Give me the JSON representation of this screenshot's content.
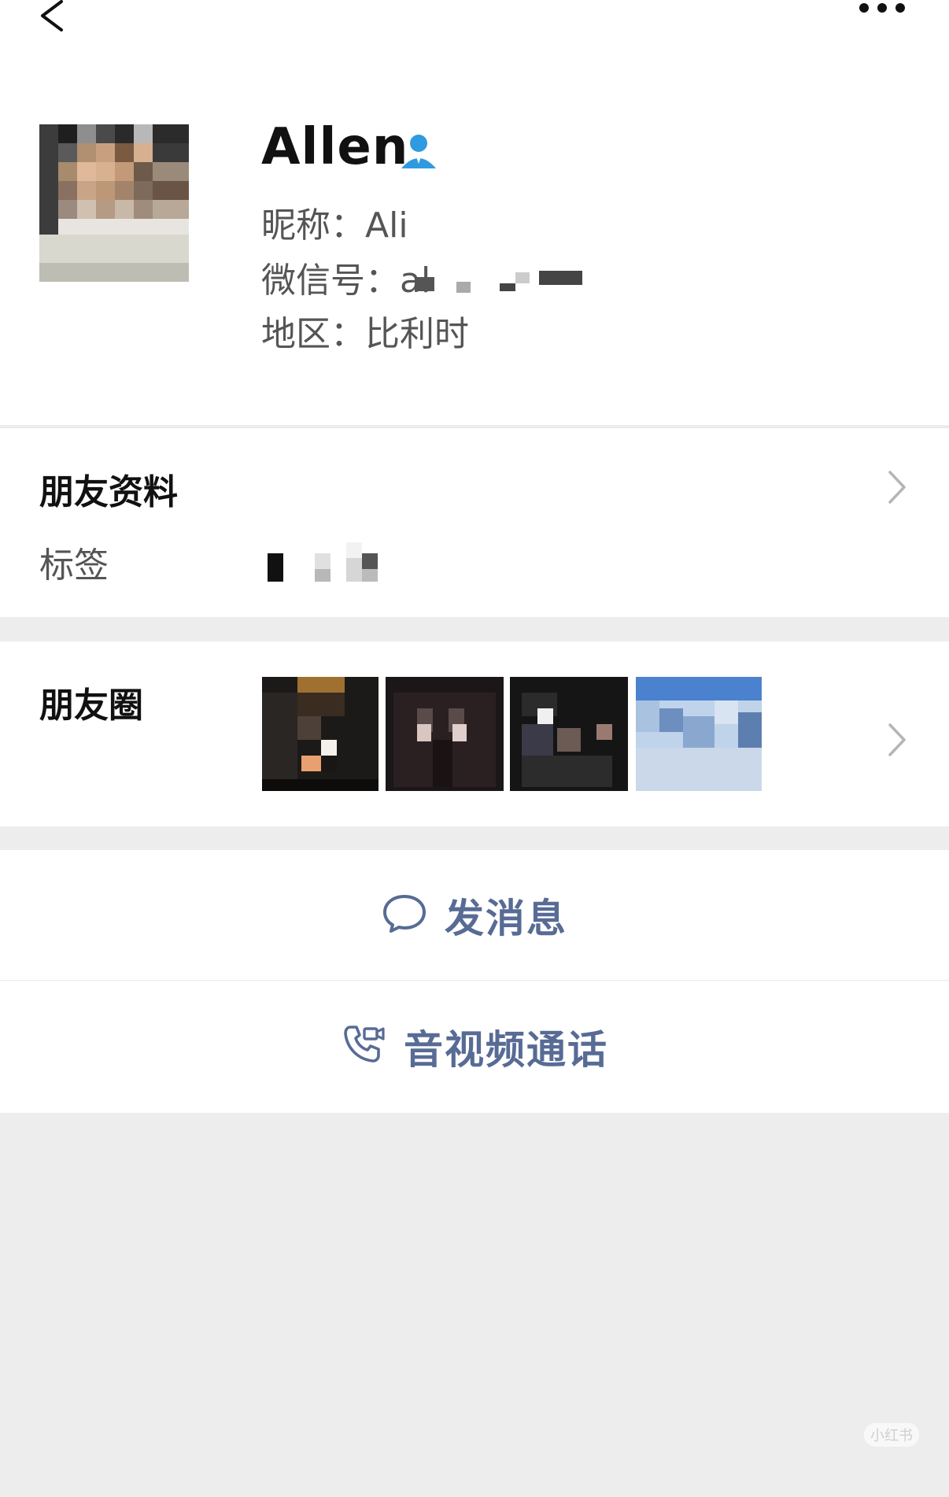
{
  "profile": {
    "name": "Allen",
    "nickname_line": "昵称：Ali",
    "wechat_id_line": "微信号：al",
    "region_line": "地区：比利时"
  },
  "friend_info": {
    "title": "朋友资料",
    "tag_label": "标签"
  },
  "moments": {
    "title": "朋友圈"
  },
  "actions": {
    "send_message": "发消息",
    "av_call": "音视频通话"
  },
  "icons": {
    "back": "chevron-left-icon",
    "more": "more-dots-icon",
    "verified": "user-badge-icon",
    "message": "chat-bubble-icon",
    "call": "phone-video-icon"
  },
  "colors": {
    "accent": "#576b95",
    "badge": "#2f9ae0"
  },
  "watermark": "小红书"
}
